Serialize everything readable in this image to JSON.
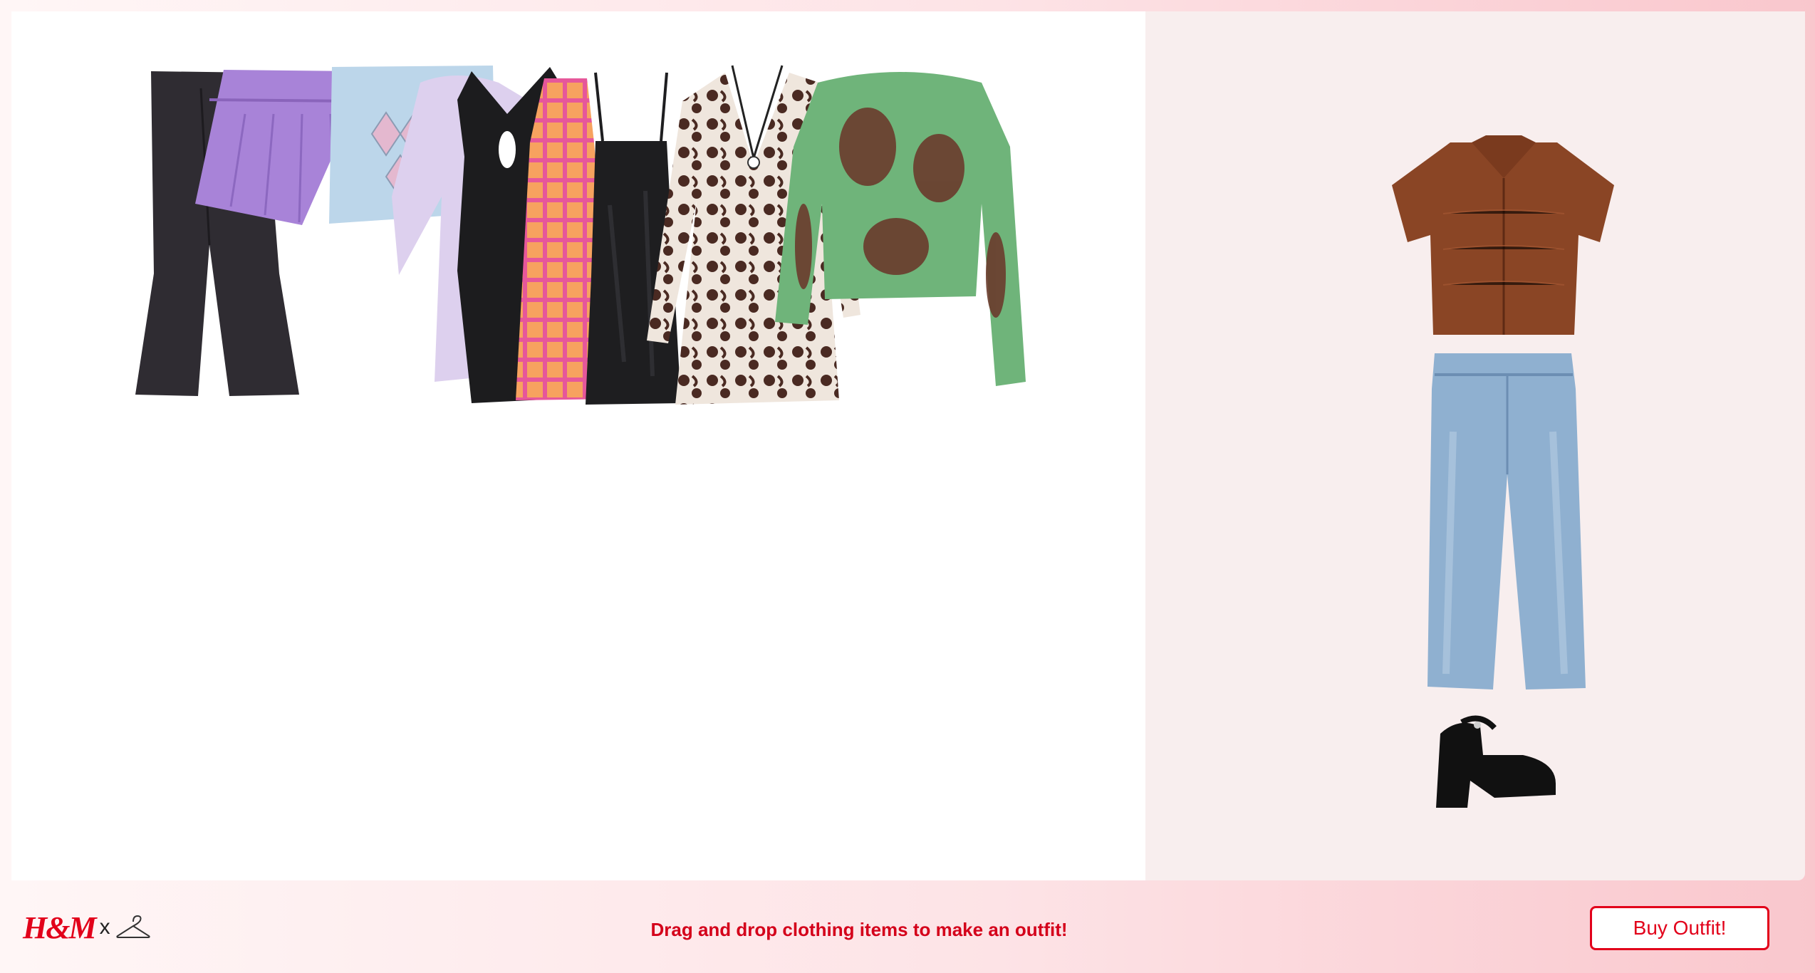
{
  "closet": {
    "items": [
      {
        "name": "flare-trousers",
        "color": "#2f2c32"
      },
      {
        "name": "pleated-skirt",
        "color": "#a883d8"
      },
      {
        "name": "argyle-skirt",
        "color": "#bcd6ea"
      },
      {
        "name": "puff-sleeve-dress",
        "color": "#ddd0ee"
      },
      {
        "name": "halter-dress",
        "color": "#1c1c1e"
      },
      {
        "name": "plaid-dress",
        "color": "#f2955b"
      },
      {
        "name": "velvet-slip-dress",
        "color": "#1e1e20"
      },
      {
        "name": "floral-halter-dress",
        "color": "#4a2a22"
      },
      {
        "name": "graphic-mesh-top",
        "color": "#6fb47a"
      }
    ]
  },
  "outfit": {
    "items": [
      {
        "name": "brown-collared-top",
        "color": "#8a4525"
      },
      {
        "name": "straight-leg-jeans",
        "color": "#8fb0d0"
      },
      {
        "name": "platform-sandals",
        "color": "#111111"
      }
    ]
  },
  "footer": {
    "logo_text": "H&M",
    "logo_separator": "x",
    "instruction": "Drag and drop clothing items to make an outfit!",
    "buy_label": "Buy Outfit!"
  },
  "colors": {
    "accent": "#e2001a",
    "instruction_text": "#d4001a",
    "outfit_panel_bg": "#f8eeee"
  }
}
